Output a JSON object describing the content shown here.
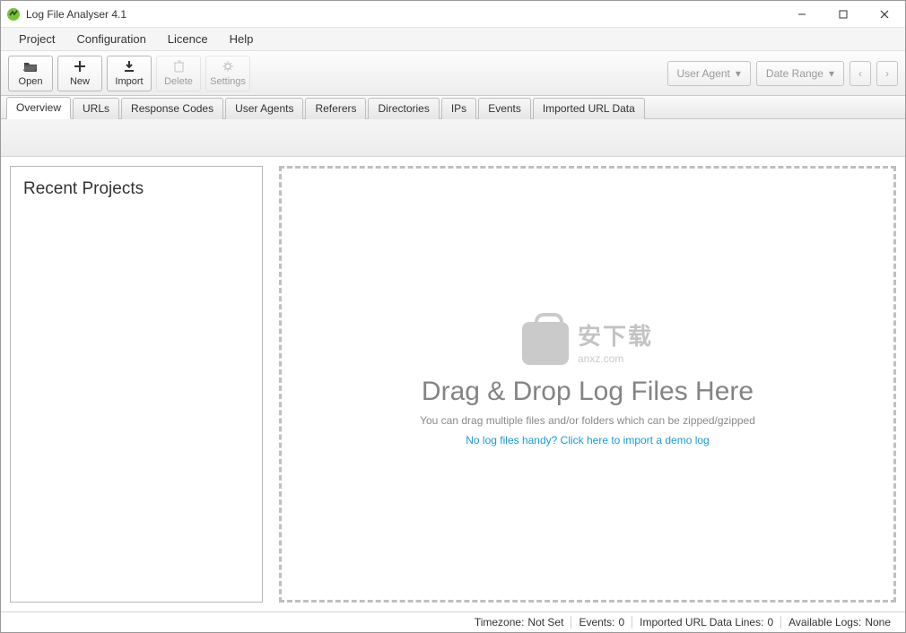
{
  "window": {
    "title": "Log File Analyser 4.1"
  },
  "menu": {
    "items": [
      "Project",
      "Configuration",
      "Licence",
      "Help"
    ]
  },
  "toolbar": {
    "buttons": [
      {
        "id": "open",
        "label": "Open",
        "icon": "folder-open",
        "enabled": true
      },
      {
        "id": "new",
        "label": "New",
        "icon": "plus",
        "enabled": true
      },
      {
        "id": "import",
        "label": "Import",
        "icon": "download",
        "enabled": true
      },
      {
        "id": "delete",
        "label": "Delete",
        "icon": "trash",
        "enabled": false
      },
      {
        "id": "settings",
        "label": "Settings",
        "icon": "gear",
        "enabled": false
      }
    ],
    "user_agent_label": "User Agent",
    "date_range_label": "Date Range"
  },
  "tabs": {
    "items": [
      "Overview",
      "URLs",
      "Response Codes",
      "User Agents",
      "Referers",
      "Directories",
      "IPs",
      "Events",
      "Imported URL Data"
    ],
    "active_index": 0
  },
  "sidebar": {
    "heading": "Recent Projects"
  },
  "dropzone": {
    "headline": "Drag & Drop Log Files Here",
    "sub": "You can drag multiple files and/or folders which can be zipped/gzipped",
    "link": "No log files handy? Click here to import a demo log"
  },
  "watermark": {
    "line1": "安下载",
    "line2": "anxz.com"
  },
  "status": {
    "timezone_label": "Timezone:",
    "timezone_value": "Not Set",
    "events_label": "Events:",
    "events_value": "0",
    "imported_label": "Imported URL Data Lines:",
    "imported_value": "0",
    "logs_label": "Available Logs:",
    "logs_value": "None"
  }
}
